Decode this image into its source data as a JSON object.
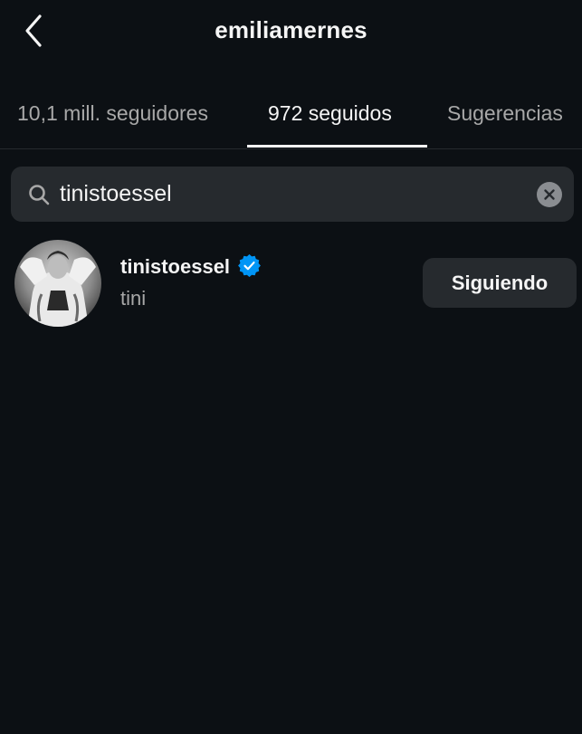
{
  "header": {
    "title": "emiliamernes",
    "back_icon": "chevron-left-icon"
  },
  "tabs": [
    {
      "label": "10,1 mill. seguidores",
      "active": false
    },
    {
      "label": "972 seguidos",
      "active": true
    },
    {
      "label": "Sugerencias",
      "active": false
    }
  ],
  "search": {
    "value": "tinistoessel",
    "icon": "search-icon",
    "clear_icon": "clear-icon"
  },
  "results": [
    {
      "username": "tinistoessel",
      "full_name": "tini",
      "verified": true,
      "button_label": "Siguiendo"
    }
  ],
  "colors": {
    "background": "#0c1014",
    "surface": "#262a2e",
    "text_primary": "#f5f5f5",
    "text_secondary": "#a8a8a8",
    "verified_blue": "#0095f6"
  }
}
